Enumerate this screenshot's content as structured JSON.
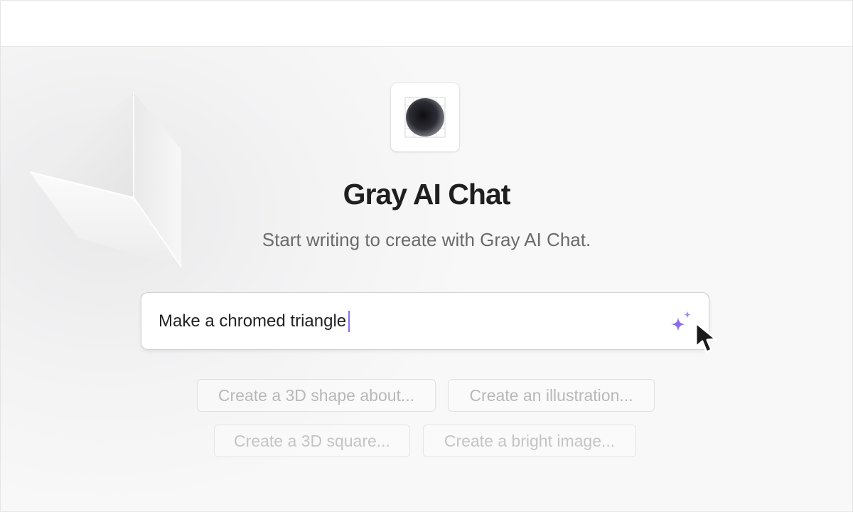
{
  "app": {
    "title": "Gray AI Chat",
    "subtitle": "Start writing to create with Gray AI Chat."
  },
  "prompt": {
    "value": "Make a chromed triangle"
  },
  "suggestions": [
    {
      "label": "Create a 3D shape about..."
    },
    {
      "label": "Create an illustration..."
    },
    {
      "label": "Create a 3D square..."
    },
    {
      "label": "Create a bright image..."
    }
  ],
  "icons": {
    "logo": "dark-sphere-logo-icon",
    "generate": "sparkle-icon",
    "pointer": "mouse-cursor-icon",
    "decoration": "chrome-triangle-shape"
  },
  "colors": {
    "accent": "#8b6cf0",
    "title": "#1f1f1f",
    "subtitle": "#6b6b6b",
    "chip_text": "#b8b8b8"
  }
}
